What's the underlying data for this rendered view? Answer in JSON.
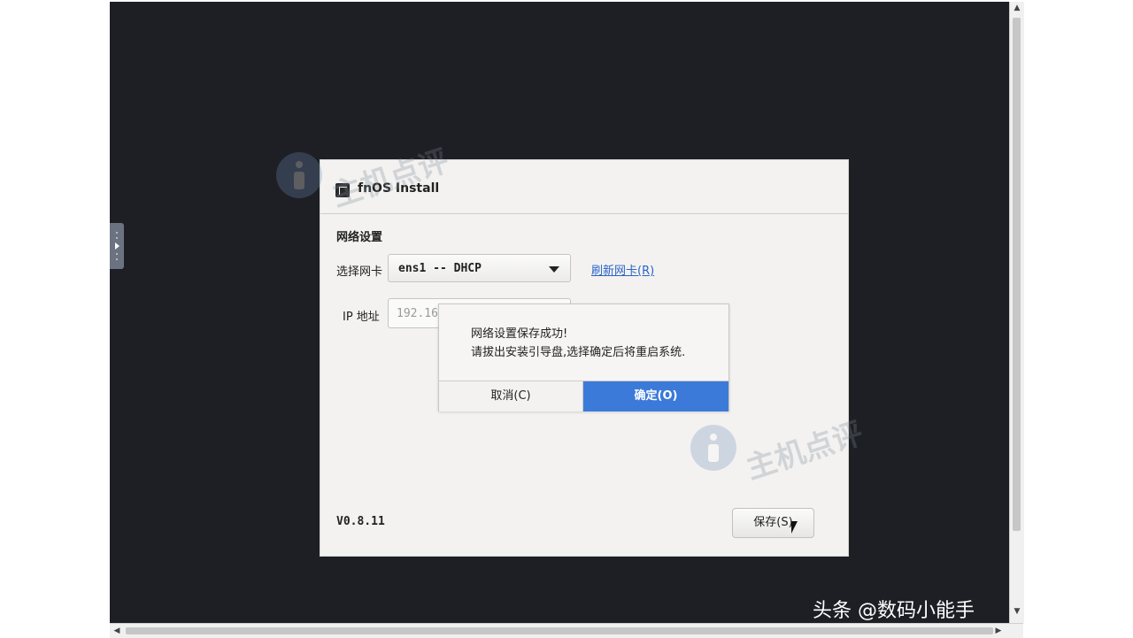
{
  "installer": {
    "title": "fnOS Install",
    "section_title": "网络设置",
    "nic_label": "选择网卡",
    "nic_selected": "ens1 -- DHCP",
    "refresh_link": "刷新网卡(R)",
    "ip_label": "IP 地址",
    "ip_value": "192.16",
    "version": "V0.8.11",
    "save_button": "保存(S)"
  },
  "dialog": {
    "line1": "网络设置保存成功!",
    "line2": "请拔出安装引导盘,选择确定后将重启系统.",
    "cancel_button": "取消(C)",
    "ok_button": "确定(O)"
  },
  "watermark": {
    "text_top": "主机点评",
    "text_bottom": "主机点评"
  },
  "credit": "头条 @数码小能手",
  "colors": {
    "console_bg": "#1e1f25",
    "window_bg": "#f3f2f1",
    "accent": "#3c7ad9",
    "link": "#2a64c8"
  }
}
